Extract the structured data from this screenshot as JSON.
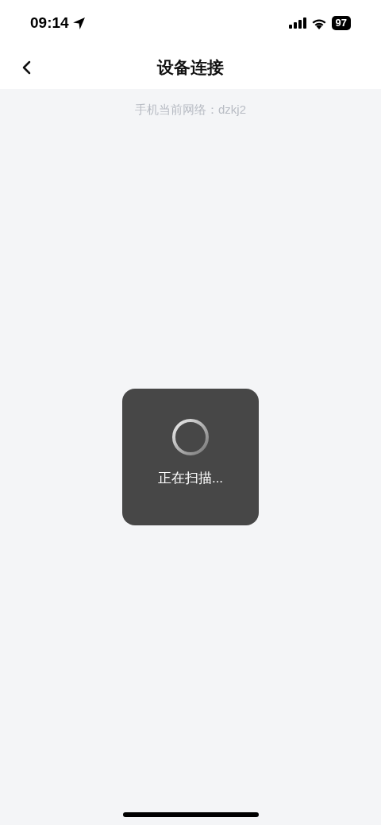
{
  "status_bar": {
    "time": "09:14",
    "battery": "97"
  },
  "nav": {
    "title": "设备连接"
  },
  "network_label": "手机当前网络：dzkj2",
  "toast": {
    "text": "正在扫描..."
  }
}
